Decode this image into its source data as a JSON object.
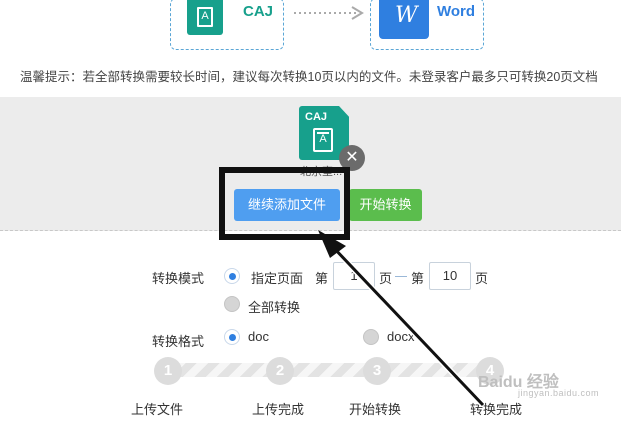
{
  "formats": {
    "from_label": "CAJ",
    "to_label": "Word",
    "from_icon_letter": "A",
    "to_icon_letter": "W",
    "from_color": "#17a08c",
    "to_color": "#2f7fe0"
  },
  "tip": "温馨提示：若全部转换需要较长时间，建议每次转换10页以内的文件。未登录客户最多只可转换20页文档",
  "upload": {
    "file_type": "CAJ",
    "file_icon_letter": "A",
    "file_name": "北京室...",
    "remove_icon": "close-icon",
    "add_button": "继续添加文件",
    "start_button": "开始转换",
    "add_button_color": "#4f9ef0",
    "start_button_color": "#5bbd4d"
  },
  "mode": {
    "label": "转换模式",
    "option_specified": "指定页面",
    "prefix_from": "第",
    "from_value": "1",
    "unit_from": "页",
    "prefix_to": "第",
    "to_value": "10",
    "unit_to": "页",
    "option_all": "全部转换",
    "selected": "指定页面"
  },
  "format": {
    "label": "转换格式",
    "option_doc": "doc",
    "option_docx": "docx",
    "selected": "doc"
  },
  "steps": [
    {
      "num": "1",
      "label": "上传文件"
    },
    {
      "num": "2",
      "label": "上传完成"
    },
    {
      "num": "3",
      "label": "开始转换"
    },
    {
      "num": "4",
      "label": "转换完成"
    }
  ],
  "watermark": {
    "text": "Baidu 经验",
    "sub": "jingyan.baidu.com"
  }
}
